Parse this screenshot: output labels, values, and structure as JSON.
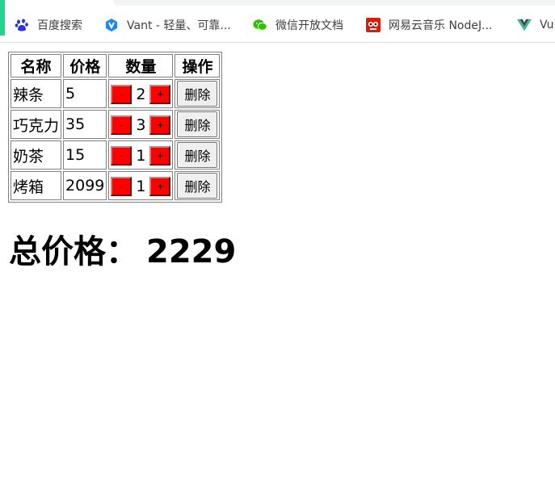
{
  "bookmarks": [
    {
      "label": "百度搜索",
      "icon": "baidu-paw-icon"
    },
    {
      "label": "Vant - 轻量、可靠...",
      "icon": "vant-icon"
    },
    {
      "label": "微信开放文档",
      "icon": "wechat-icon"
    },
    {
      "label": "网易云音乐 NodeJ...",
      "icon": "netease-icon"
    },
    {
      "label": "Vu",
      "icon": "vue-icon"
    }
  ],
  "table": {
    "headers": [
      "名称",
      "价格",
      "数量",
      "操作"
    ],
    "rows": [
      {
        "name": "辣条",
        "price": "5",
        "qty": "2",
        "minus": "-",
        "plus": "+",
        "delete": "删除"
      },
      {
        "name": "巧克力",
        "price": "35",
        "qty": "3",
        "minus": "-",
        "plus": "+",
        "delete": "删除"
      },
      {
        "name": "奶茶",
        "price": "15",
        "qty": "1",
        "minus": "-",
        "plus": "+",
        "delete": "删除"
      },
      {
        "name": "烤箱",
        "price": "2099",
        "qty": "1",
        "minus": "-",
        "plus": "+",
        "delete": "删除"
      }
    ]
  },
  "total": {
    "label": "总价格：",
    "value": "2229"
  },
  "colors": {
    "qty_button": "#ff0000",
    "accent": "#1ed68c",
    "baidu": "#2932e1",
    "vant": "#1989fa",
    "wechat": "#2dc100",
    "netease": "#d81e06",
    "vue": "#41b883"
  }
}
